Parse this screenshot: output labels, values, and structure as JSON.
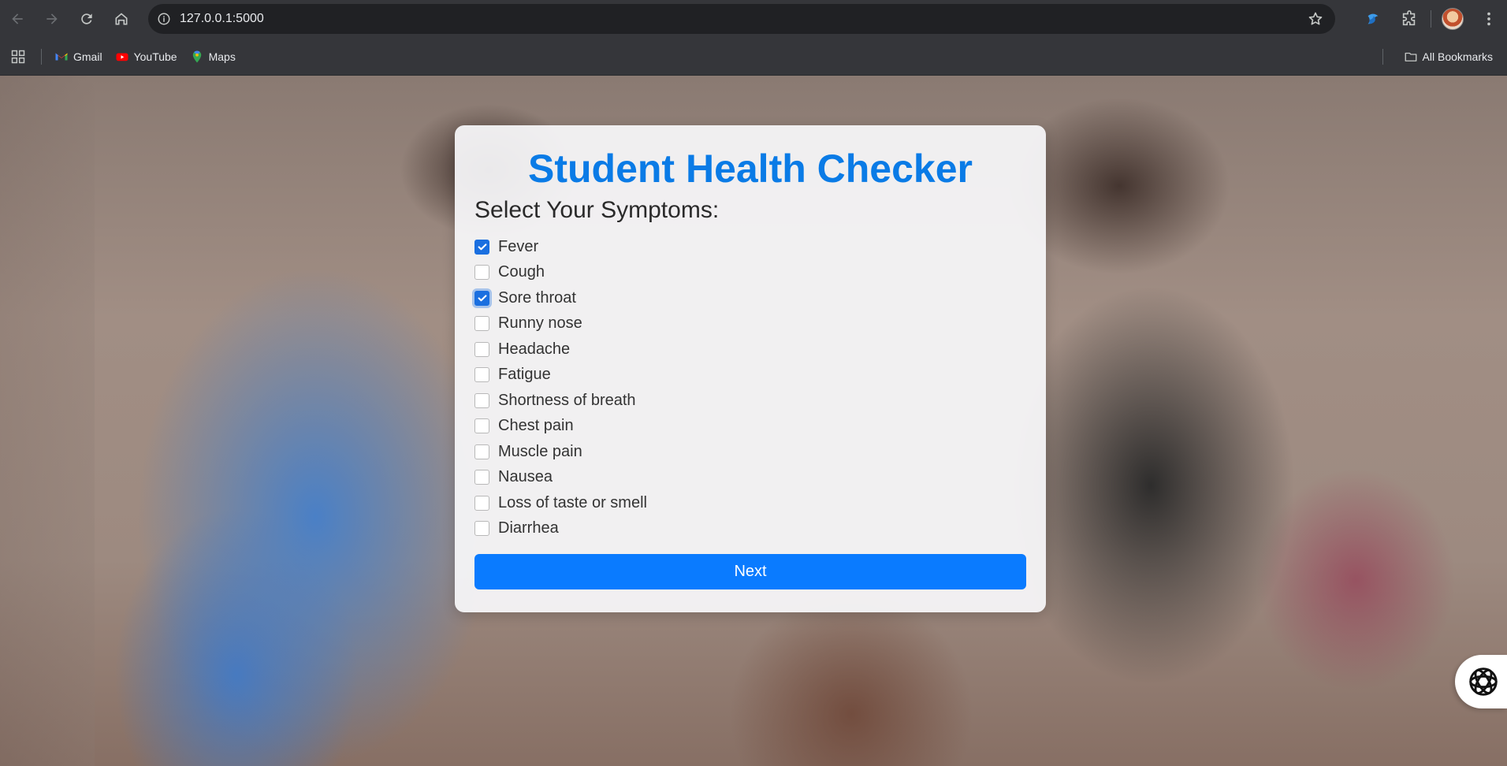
{
  "browser": {
    "url": "127.0.0.1:5000",
    "bookmarks": [
      {
        "label": "Gmail",
        "icon": "gmail-icon"
      },
      {
        "label": "YouTube",
        "icon": "youtube-icon"
      },
      {
        "label": "Maps",
        "icon": "maps-icon"
      }
    ],
    "all_bookmarks_label": "All Bookmarks"
  },
  "page": {
    "title": "Student Health Checker",
    "subtitle": "Select Your Symptoms:",
    "symptoms": [
      {
        "label": "Fever",
        "checked": true
      },
      {
        "label": "Cough",
        "checked": false
      },
      {
        "label": "Sore throat",
        "checked": true
      },
      {
        "label": "Runny nose",
        "checked": false
      },
      {
        "label": "Headache",
        "checked": false
      },
      {
        "label": "Fatigue",
        "checked": false
      },
      {
        "label": "Shortness of breath",
        "checked": false
      },
      {
        "label": "Chest pain",
        "checked": false
      },
      {
        "label": "Muscle pain",
        "checked": false
      },
      {
        "label": "Nausea",
        "checked": false
      },
      {
        "label": "Loss of taste or smell",
        "checked": false
      },
      {
        "label": "Diarrhea",
        "checked": false
      }
    ],
    "next_label": "Next",
    "accent_color": "#0a7bff",
    "title_color": "#0a7be6"
  }
}
